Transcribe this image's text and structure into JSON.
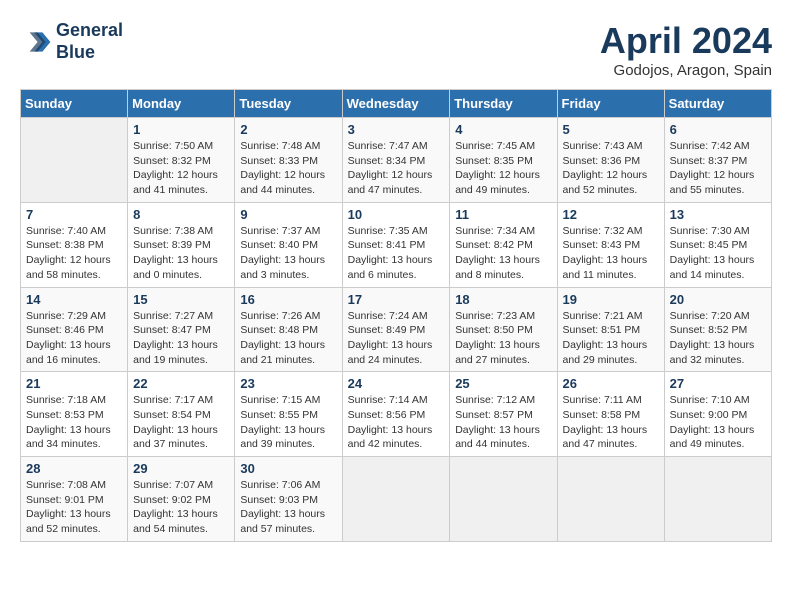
{
  "header": {
    "logo_line1": "General",
    "logo_line2": "Blue",
    "month": "April 2024",
    "location": "Godojos, Aragon, Spain"
  },
  "days_of_week": [
    "Sunday",
    "Monday",
    "Tuesday",
    "Wednesday",
    "Thursday",
    "Friday",
    "Saturday"
  ],
  "weeks": [
    [
      {
        "num": "",
        "info": ""
      },
      {
        "num": "1",
        "info": "Sunrise: 7:50 AM\nSunset: 8:32 PM\nDaylight: 12 hours\nand 41 minutes."
      },
      {
        "num": "2",
        "info": "Sunrise: 7:48 AM\nSunset: 8:33 PM\nDaylight: 12 hours\nand 44 minutes."
      },
      {
        "num": "3",
        "info": "Sunrise: 7:47 AM\nSunset: 8:34 PM\nDaylight: 12 hours\nand 47 minutes."
      },
      {
        "num": "4",
        "info": "Sunrise: 7:45 AM\nSunset: 8:35 PM\nDaylight: 12 hours\nand 49 minutes."
      },
      {
        "num": "5",
        "info": "Sunrise: 7:43 AM\nSunset: 8:36 PM\nDaylight: 12 hours\nand 52 minutes."
      },
      {
        "num": "6",
        "info": "Sunrise: 7:42 AM\nSunset: 8:37 PM\nDaylight: 12 hours\nand 55 minutes."
      }
    ],
    [
      {
        "num": "7",
        "info": "Sunrise: 7:40 AM\nSunset: 8:38 PM\nDaylight: 12 hours\nand 58 minutes."
      },
      {
        "num": "8",
        "info": "Sunrise: 7:38 AM\nSunset: 8:39 PM\nDaylight: 13 hours\nand 0 minutes."
      },
      {
        "num": "9",
        "info": "Sunrise: 7:37 AM\nSunset: 8:40 PM\nDaylight: 13 hours\nand 3 minutes."
      },
      {
        "num": "10",
        "info": "Sunrise: 7:35 AM\nSunset: 8:41 PM\nDaylight: 13 hours\nand 6 minutes."
      },
      {
        "num": "11",
        "info": "Sunrise: 7:34 AM\nSunset: 8:42 PM\nDaylight: 13 hours\nand 8 minutes."
      },
      {
        "num": "12",
        "info": "Sunrise: 7:32 AM\nSunset: 8:43 PM\nDaylight: 13 hours\nand 11 minutes."
      },
      {
        "num": "13",
        "info": "Sunrise: 7:30 AM\nSunset: 8:45 PM\nDaylight: 13 hours\nand 14 minutes."
      }
    ],
    [
      {
        "num": "14",
        "info": "Sunrise: 7:29 AM\nSunset: 8:46 PM\nDaylight: 13 hours\nand 16 minutes."
      },
      {
        "num": "15",
        "info": "Sunrise: 7:27 AM\nSunset: 8:47 PM\nDaylight: 13 hours\nand 19 minutes."
      },
      {
        "num": "16",
        "info": "Sunrise: 7:26 AM\nSunset: 8:48 PM\nDaylight: 13 hours\nand 21 minutes."
      },
      {
        "num": "17",
        "info": "Sunrise: 7:24 AM\nSunset: 8:49 PM\nDaylight: 13 hours\nand 24 minutes."
      },
      {
        "num": "18",
        "info": "Sunrise: 7:23 AM\nSunset: 8:50 PM\nDaylight: 13 hours\nand 27 minutes."
      },
      {
        "num": "19",
        "info": "Sunrise: 7:21 AM\nSunset: 8:51 PM\nDaylight: 13 hours\nand 29 minutes."
      },
      {
        "num": "20",
        "info": "Sunrise: 7:20 AM\nSunset: 8:52 PM\nDaylight: 13 hours\nand 32 minutes."
      }
    ],
    [
      {
        "num": "21",
        "info": "Sunrise: 7:18 AM\nSunset: 8:53 PM\nDaylight: 13 hours\nand 34 minutes."
      },
      {
        "num": "22",
        "info": "Sunrise: 7:17 AM\nSunset: 8:54 PM\nDaylight: 13 hours\nand 37 minutes."
      },
      {
        "num": "23",
        "info": "Sunrise: 7:15 AM\nSunset: 8:55 PM\nDaylight: 13 hours\nand 39 minutes."
      },
      {
        "num": "24",
        "info": "Sunrise: 7:14 AM\nSunset: 8:56 PM\nDaylight: 13 hours\nand 42 minutes."
      },
      {
        "num": "25",
        "info": "Sunrise: 7:12 AM\nSunset: 8:57 PM\nDaylight: 13 hours\nand 44 minutes."
      },
      {
        "num": "26",
        "info": "Sunrise: 7:11 AM\nSunset: 8:58 PM\nDaylight: 13 hours\nand 47 minutes."
      },
      {
        "num": "27",
        "info": "Sunrise: 7:10 AM\nSunset: 9:00 PM\nDaylight: 13 hours\nand 49 minutes."
      }
    ],
    [
      {
        "num": "28",
        "info": "Sunrise: 7:08 AM\nSunset: 9:01 PM\nDaylight: 13 hours\nand 52 minutes."
      },
      {
        "num": "29",
        "info": "Sunrise: 7:07 AM\nSunset: 9:02 PM\nDaylight: 13 hours\nand 54 minutes."
      },
      {
        "num": "30",
        "info": "Sunrise: 7:06 AM\nSunset: 9:03 PM\nDaylight: 13 hours\nand 57 minutes."
      },
      {
        "num": "",
        "info": ""
      },
      {
        "num": "",
        "info": ""
      },
      {
        "num": "",
        "info": ""
      },
      {
        "num": "",
        "info": ""
      }
    ]
  ]
}
